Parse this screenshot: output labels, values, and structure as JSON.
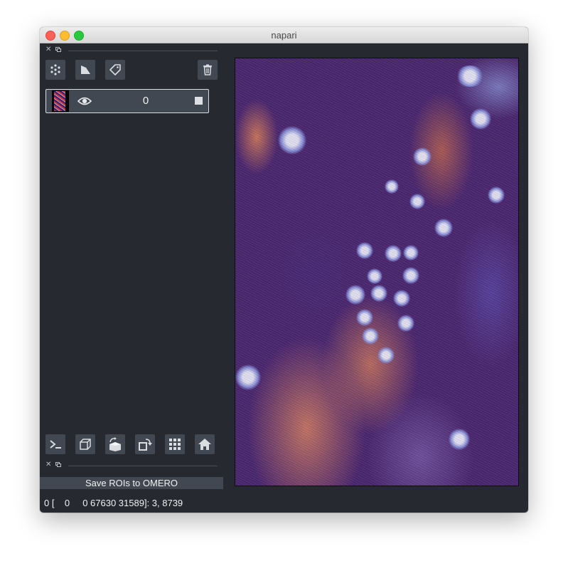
{
  "window": {
    "title": "napari"
  },
  "layer_controls_toolbar": {
    "add_points_icon": "points-icon",
    "add_shapes_icon": "shapes-icon",
    "add_labels_icon": "label-tag-icon",
    "delete_layer_icon": "trash-icon"
  },
  "layers": [
    {
      "name": "0",
      "visible": true
    }
  ],
  "viewer_buttons": [
    {
      "icon": "console-icon"
    },
    {
      "icon": "3d-toggle-icon"
    },
    {
      "icon": "roll-dims-icon"
    },
    {
      "icon": "transpose-icon"
    },
    {
      "icon": "grid-icon"
    },
    {
      "icon": "home-icon"
    }
  ],
  "plugin": {
    "save_label": "Save ROIs to OMERO"
  },
  "status_bar": {
    "text": "0 [    0     0 67630 31589]: 3, 8739"
  },
  "colors": {
    "window_bg": "#262930",
    "panel_button": "#414851",
    "text": "#f0f1f2"
  }
}
